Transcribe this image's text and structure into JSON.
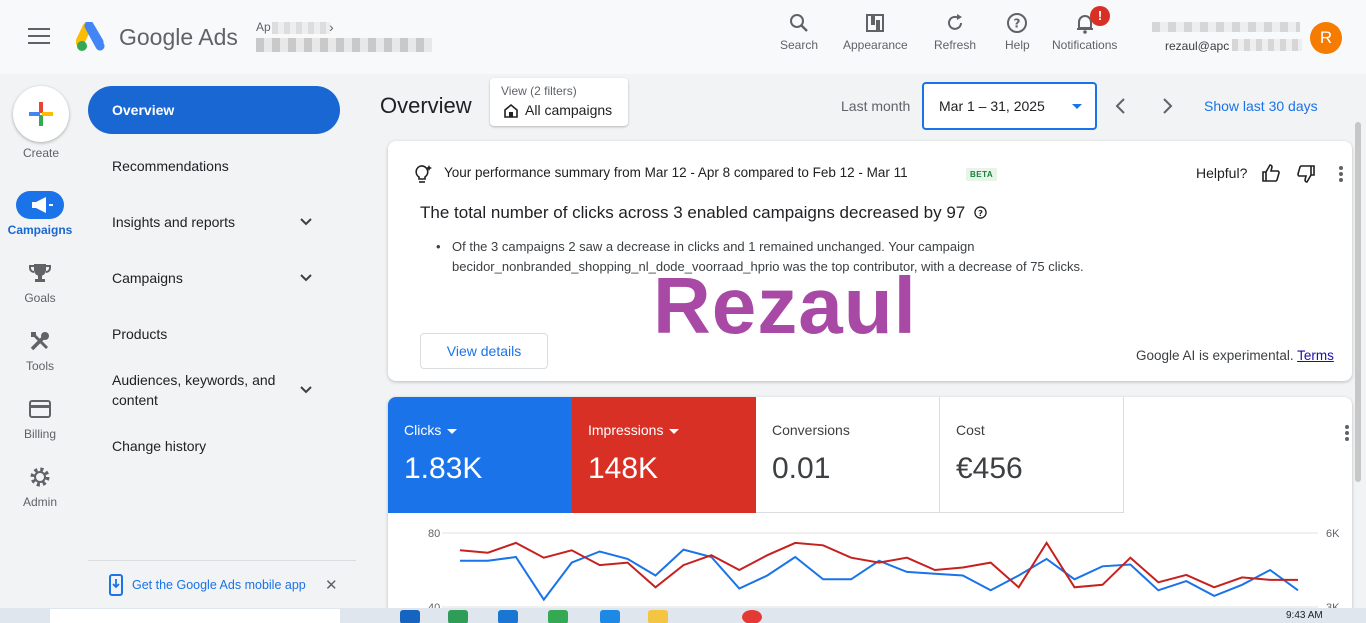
{
  "header": {
    "brand": "Google Ads",
    "account_label_partial": "Ap",
    "tools": [
      {
        "name": "search",
        "label": "Search"
      },
      {
        "name": "appearance",
        "label": "Appearance"
      },
      {
        "name": "refresh",
        "label": "Refresh"
      },
      {
        "name": "help",
        "label": "Help"
      },
      {
        "name": "notifications",
        "label": "Notifications"
      }
    ],
    "notification_badge": "!",
    "user_email_partial": "rezaul@apc",
    "avatar_initial": "R",
    "avatar_color": "#f57c00"
  },
  "rail": {
    "create_label": "Create",
    "items": [
      {
        "name": "campaigns",
        "label": "Campaigns",
        "active": true
      },
      {
        "name": "goals",
        "label": "Goals"
      },
      {
        "name": "tools",
        "label": "Tools"
      },
      {
        "name": "billing",
        "label": "Billing"
      },
      {
        "name": "admin",
        "label": "Admin"
      }
    ]
  },
  "nav": {
    "active": "Overview",
    "items": [
      {
        "label": "Recommendations",
        "expandable": false
      },
      {
        "label": "Insights and reports",
        "expandable": true
      },
      {
        "label": "Campaigns",
        "expandable": true
      },
      {
        "label": "Products",
        "expandable": false
      },
      {
        "label": "Audiences, keywords, and content",
        "expandable": true
      },
      {
        "label": "Change history",
        "expandable": false
      }
    ],
    "mobile_app": "Get the Google Ads mobile app"
  },
  "page": {
    "title": "Overview",
    "filter_label": "View (2 filters)",
    "filter_value": "All campaigns",
    "date_preset": "Last month",
    "date_range": "Mar 1 – 31, 2025",
    "show_last": "Show last 30 days"
  },
  "summary": {
    "heading": "Your performance summary from Mar 12 - Apr 8 compared to Feb 12 - Mar 11",
    "beta": "BETA",
    "helpful": "Helpful?",
    "title": "The total number of clicks across 3 enabled campaigns decreased by 97",
    "bullet": "Of the 3 campaigns 2 saw a decrease in clicks and 1 remained unchanged. Your campaign becidor_nonbranded_shopping_nl_dode_voorraad_hprio was the top contributor, with a decrease of 75 clicks.",
    "view_details": "View details",
    "ai_note": "Google AI is experimental.",
    "terms": "Terms"
  },
  "watermark": "Rezaul",
  "metrics": [
    {
      "name": "Clicks",
      "value": "1.83K",
      "bg": "#1a73e8",
      "dropdown": true
    },
    {
      "name": "Impressions",
      "value": "148K",
      "bg": "#d93025",
      "dropdown": true
    },
    {
      "name": "Conversions",
      "value": "0.01",
      "bg": "#ffffff",
      "dropdown": false
    },
    {
      "name": "Cost",
      "value": "€456",
      "bg": "#ffffff",
      "dropdown": false
    }
  ],
  "chart_data": {
    "type": "line",
    "title": "",
    "y_left_ticks": [
      "80",
      "40"
    ],
    "y_right_ticks": [
      "6K",
      "3K"
    ],
    "series": [
      {
        "name": "Clicks",
        "color": "#1a73e8",
        "axis": "left",
        "values": [
          65,
          65,
          67,
          44,
          64,
          70,
          66,
          57,
          71,
          67,
          50,
          57,
          67,
          55,
          55,
          65,
          59,
          58,
          57,
          49,
          57,
          66,
          55,
          62,
          63,
          49,
          54,
          46,
          52,
          60,
          49
        ]
      },
      {
        "name": "Impressions",
        "color": "#c5221f",
        "axis": "right",
        "values": [
          5.3,
          5.2,
          5.6,
          5.0,
          5.3,
          4.7,
          4.8,
          3.8,
          4.7,
          5.1,
          4.5,
          5.1,
          5.6,
          5.5,
          5.0,
          4.8,
          5.0,
          4.5,
          4.6,
          4.8,
          3.8,
          5.6,
          3.8,
          3.9,
          5.0,
          4.0,
          4.3,
          3.8,
          4.2,
          4.1,
          4.1
        ]
      }
    ],
    "y_left_range": [
      40,
      80
    ],
    "y_right_range": [
      3,
      6
    ]
  },
  "taskbar": {
    "time": "9:43 AM"
  }
}
